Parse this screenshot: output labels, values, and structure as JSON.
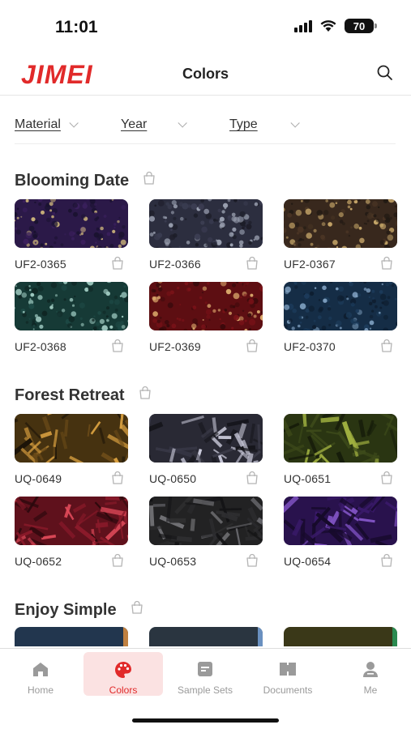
{
  "status_bar": {
    "time": "11:01",
    "battery": "70"
  },
  "header": {
    "brand": "JIMEI",
    "title": "Colors"
  },
  "colors": {
    "brand_red": "#e12a2a",
    "active_tab_bg": "#fbe2e2"
  },
  "filters": [
    {
      "label": "Material"
    },
    {
      "label": "Year"
    },
    {
      "label": "Type"
    }
  ],
  "sections": [
    {
      "title": "Blooming Date",
      "items": [
        {
          "code": "UF2-0365",
          "swatch": [
            "#3a1f5c",
            "#c9b27a",
            "#1a1230"
          ]
        },
        {
          "code": "UF2-0366",
          "swatch": [
            "#3b3d52",
            "#9aa0b0",
            "#1c1d28"
          ]
        },
        {
          "code": "UF2-0367",
          "swatch": [
            "#4a3524",
            "#c8a86a",
            "#221a14"
          ]
        },
        {
          "code": "UF2-0368",
          "swatch": [
            "#1e4a46",
            "#9ec9c0",
            "#0f2624"
          ]
        },
        {
          "code": "UF2-0369",
          "swatch": [
            "#7a1218",
            "#e0b070",
            "#3a0a0c"
          ]
        },
        {
          "code": "UF2-0370",
          "swatch": [
            "#1c3b5a",
            "#7fa0c0",
            "#0e1e30"
          ]
        }
      ]
    },
    {
      "title": "Forest Retreat",
      "items": [
        {
          "code": "UQ-0649",
          "swatch": [
            "#6a4a18",
            "#d9a040",
            "#1c1408"
          ]
        },
        {
          "code": "UQ-0650",
          "swatch": [
            "#3a3a48",
            "#c8c8d8",
            "#16161c"
          ]
        },
        {
          "code": "UQ-0651",
          "swatch": [
            "#3d4a1a",
            "#a0b040",
            "#161c0a"
          ]
        },
        {
          "code": "UQ-0652",
          "swatch": [
            "#8a1a2a",
            "#e04a5a",
            "#2a080c"
          ]
        },
        {
          "code": "UQ-0653",
          "swatch": [
            "#2e2e30",
            "#707074",
            "#141416"
          ]
        },
        {
          "code": "UQ-0654",
          "swatch": [
            "#3a1a6a",
            "#8a5ad0",
            "#160a2a"
          ]
        }
      ]
    },
    {
      "title": "Enjoy Simple",
      "items": [
        {
          "swatch": [
            "#22364e",
            "#c08040"
          ]
        },
        {
          "swatch": [
            "#2a3540",
            "#6a90c0"
          ]
        },
        {
          "swatch": [
            "#3a3818",
            "#2a8a50"
          ]
        }
      ]
    }
  ],
  "nav": [
    {
      "label": "Home",
      "icon": "home-icon"
    },
    {
      "label": "Colors",
      "icon": "palette-icon",
      "active": true
    },
    {
      "label": "Sample Sets",
      "icon": "sample-sets-icon"
    },
    {
      "label": "Documents",
      "icon": "book-icon"
    },
    {
      "label": "Me",
      "icon": "user-icon"
    }
  ]
}
